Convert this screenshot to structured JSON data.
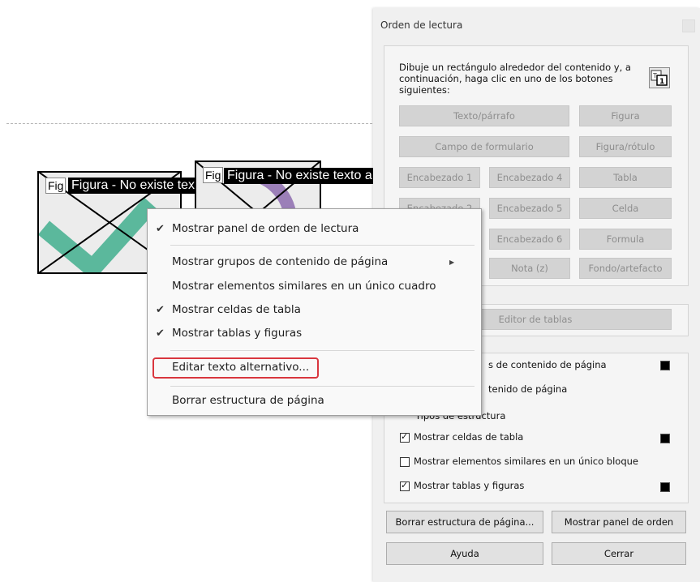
{
  "canvas": {
    "figure1": {
      "tag": "Figura - No existe texto alternativo.",
      "sub_label": "Fig"
    },
    "figure2": {
      "tag": "Figura - No existe texto a",
      "sub_label": "Fig"
    },
    "colors": {
      "green": "#5bb89c",
      "purple": "#9b7fb8"
    }
  },
  "dialog": {
    "title": "Orden de lectura",
    "instructions": "Dibuje un rectángulo alrededor del contenido y, a continuación, haga clic en uno de los botones siguientes:",
    "tool_icon": "touchup-reading-order-icon",
    "buttons": {
      "texto_parrafo": "Texto/párrafo",
      "figura": "Figura",
      "campo_formulario": "Campo de formulario",
      "figura_rotulo": "Figura/rótulo",
      "encabezado1": "Encabezado 1",
      "encabezado4": "Encabezado 4",
      "tabla": "Tabla",
      "encabezado2": "Encabezado 2",
      "encabezado5": "Encabezado 5",
      "celda": "Celda",
      "encabezado6": "Encabezado 6",
      "formula": "Formula",
      "nota": "Nota (z)",
      "fondo": "Fondo/artefacto",
      "editor_tablas": "Editor de tablas"
    },
    "options": {
      "grupos_partial": "s de contenido de página",
      "contenido_partial": "tenido de página",
      "tipos_partial": "Tipos de estructura",
      "celdas": "Mostrar celdas de tabla",
      "similares": "Mostrar elementos similares en un único bloque",
      "tablas": "Mostrar tablas y figuras"
    },
    "footer": {
      "borrar": "Borrar estructura de página...",
      "mostrar_panel": "Mostrar panel de orden",
      "ayuda": "Ayuda",
      "cerrar": "Cerrar"
    }
  },
  "context_menu": {
    "items": [
      {
        "label": "Mostrar panel de orden de lectura",
        "checked": true
      },
      {
        "label": "Mostrar grupos de contenido de página",
        "checked": false,
        "submenu": true
      },
      {
        "label": "Mostrar elementos similares en un único cuadro",
        "checked": false
      },
      {
        "label": "Mostrar celdas de tabla",
        "checked": true
      },
      {
        "label": "Mostrar tablas y figuras",
        "checked": true
      },
      {
        "label": "Editar texto alternativo...",
        "checked": false,
        "highlighted": true
      },
      {
        "label": "Borrar estructura de página",
        "checked": false
      }
    ],
    "check_glyph": "✔",
    "highlight_color": "#d9363e"
  }
}
